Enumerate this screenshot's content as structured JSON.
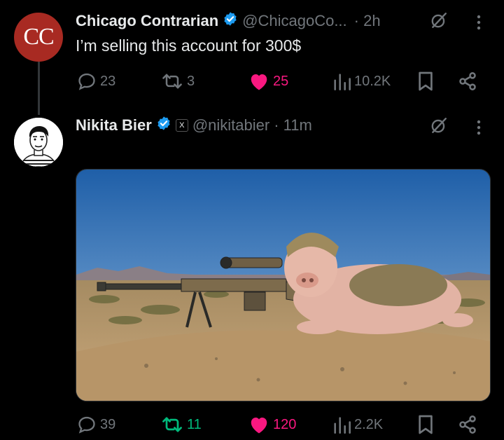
{
  "tweets": [
    {
      "avatar_text": "CC",
      "display_name": "Chicago Contrarian",
      "handle": "@ChicagoCo...",
      "time": "· 2h",
      "text": "I’m selling this account for 300$",
      "stats": {
        "replies": "23",
        "reposts": "3",
        "likes": "25",
        "views": "10.2K"
      },
      "liked": true,
      "repost_active": false
    },
    {
      "display_name": "Nikita Bier",
      "handle": "@nikitabier",
      "time": "· 11m",
      "affiliate_badge": "X",
      "stats": {
        "replies": "39",
        "reposts": "11",
        "likes": "120",
        "views": "2.2K"
      },
      "liked": true,
      "repost_active": true
    }
  ],
  "colors": {
    "background": "#000000",
    "text": "#e7e9ea",
    "muted": "#71767b",
    "verified": "#1d9bf0",
    "like": "#f91880",
    "repost": "#00ba7c",
    "avatar_cc": "#a82a22"
  },
  "icons": [
    "verified-badge-icon",
    "grok-icon",
    "more-icon",
    "reply-icon",
    "repost-icon",
    "like-icon",
    "views-icon",
    "bookmark-icon",
    "share-icon"
  ]
}
